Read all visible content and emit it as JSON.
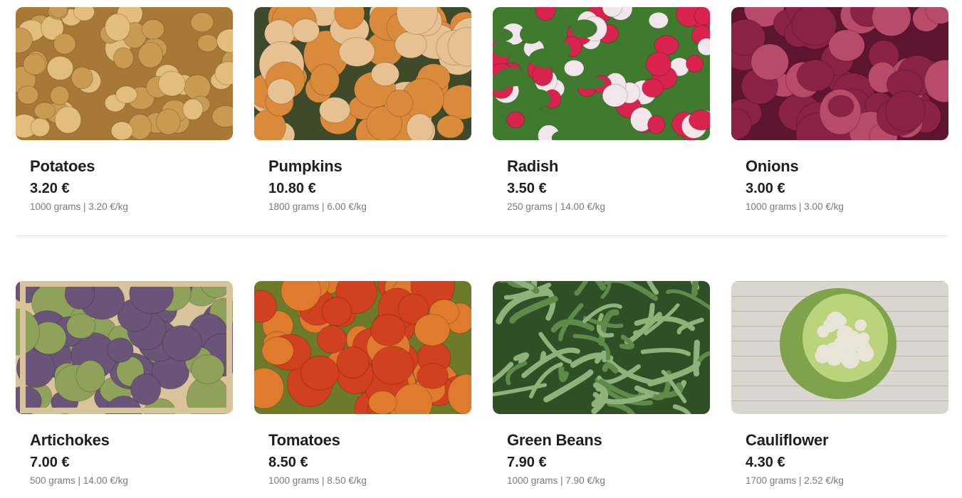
{
  "products": [
    {
      "name": "Potatoes",
      "price": "3.20 €",
      "meta": "1000 grams | 3.20 €/kg",
      "image_icon": "potatoes-photo",
      "palette": [
        "#c99a52",
        "#e2bd7c",
        "#a87836"
      ]
    },
    {
      "name": "Pumpkins",
      "price": "10.80 €",
      "meta": "1800 grams | 6.00 €/kg",
      "image_icon": "pumpkins-photo",
      "palette": [
        "#d98a3a",
        "#e8c192",
        "#3f4a2a"
      ]
    },
    {
      "name": "Radish",
      "price": "3.50 €",
      "meta": "250 grams | 14.00 €/kg",
      "image_icon": "radish-photo",
      "palette": [
        "#d8234f",
        "#f1e6ea",
        "#3f7a2e"
      ]
    },
    {
      "name": "Onions",
      "price": "3.00 €",
      "meta": "1000 grams | 3.00 €/kg",
      "image_icon": "onions-photo",
      "palette": [
        "#8a2246",
        "#b84a6a",
        "#5e1530"
      ]
    },
    {
      "name": "Artichokes",
      "price": "7.00 €",
      "meta": "500 grams | 14.00 €/kg",
      "image_icon": "artichokes-photo",
      "palette": [
        "#6a5478",
        "#8fa25a",
        "#d8c39a"
      ]
    },
    {
      "name": "Tomatoes",
      "price": "8.50 €",
      "meta": "1000 grams | 8.50 €/kg",
      "image_icon": "tomatoes-photo",
      "palette": [
        "#d1401f",
        "#e07a2c",
        "#6c7a2a"
      ]
    },
    {
      "name": "Green Beans",
      "price": "7.90 €",
      "meta": "1000 grams | 7.90 €/kg",
      "image_icon": "green-beans-photo",
      "palette": [
        "#5f8a4a",
        "#8fb27a",
        "#2f4f26"
      ]
    },
    {
      "name": "Cauliflower",
      "price": "4.30 €",
      "meta": "1700 grams | 2.52 €/kg",
      "image_icon": "cauliflower-photo",
      "palette": [
        "#e8e4d8",
        "#b9d47a",
        "#7ea34a"
      ]
    }
  ]
}
